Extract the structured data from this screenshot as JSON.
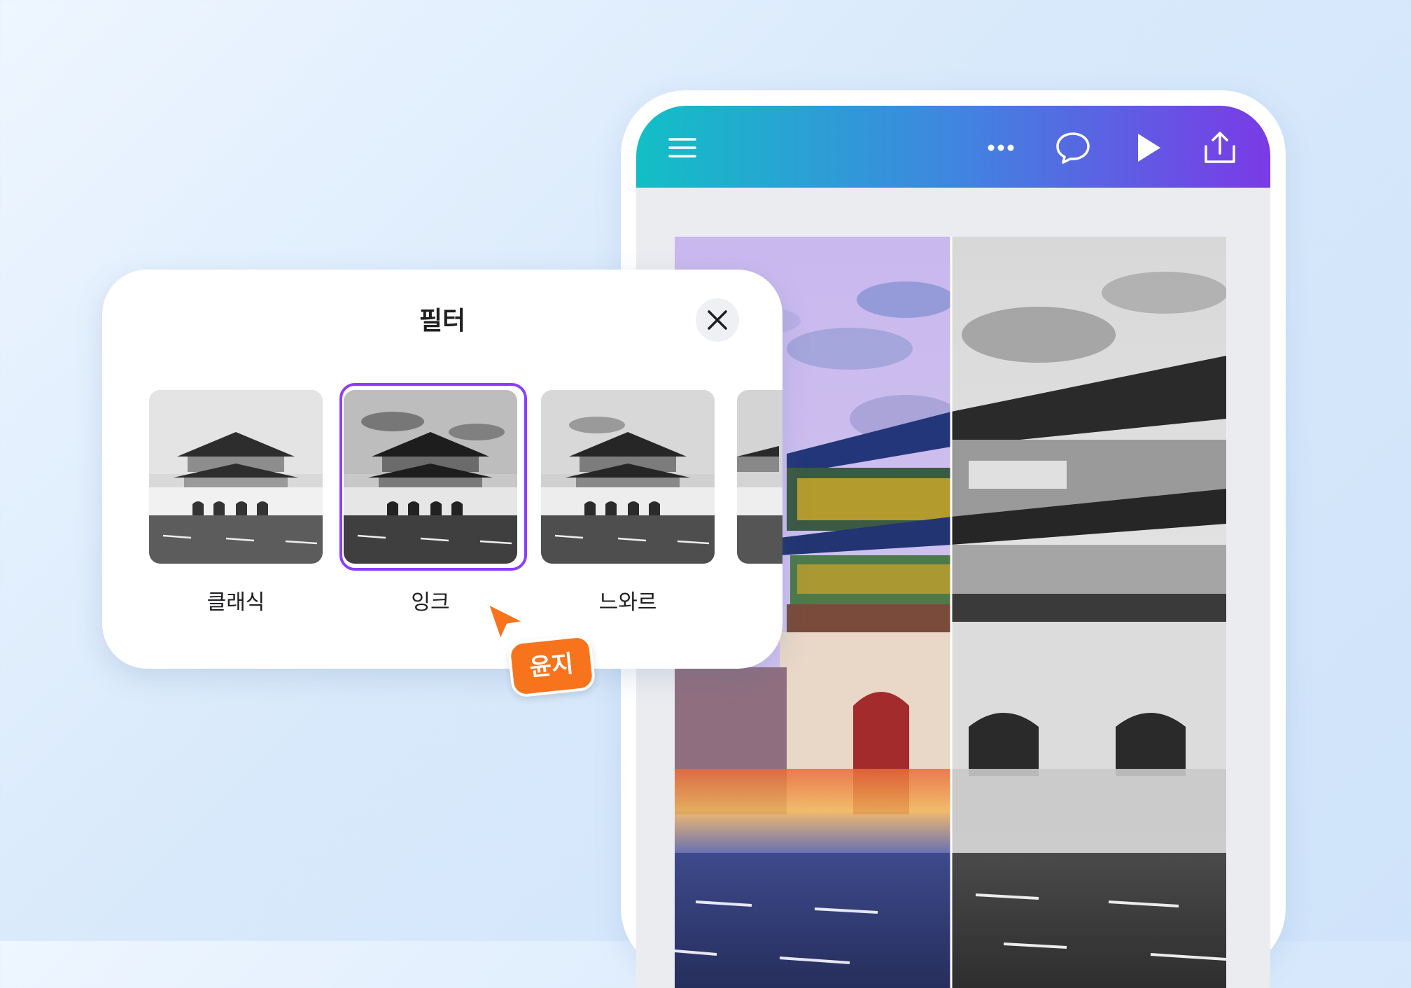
{
  "panel": {
    "title": "필터",
    "filters": [
      {
        "label": "클래식",
        "selected": false
      },
      {
        "label": "잉크",
        "selected": true
      },
      {
        "label": "느와르",
        "selected": false
      }
    ]
  },
  "collaborator": {
    "name": "윤지"
  },
  "toolbar": {
    "icons": [
      "menu-icon",
      "more-icon",
      "comment-icon",
      "play-icon",
      "share-icon"
    ]
  },
  "colors": {
    "accent": "#8b3dff",
    "cursor": "#f7731c",
    "topbar_start": "#12bfc6",
    "topbar_end": "#7a3ae6"
  }
}
